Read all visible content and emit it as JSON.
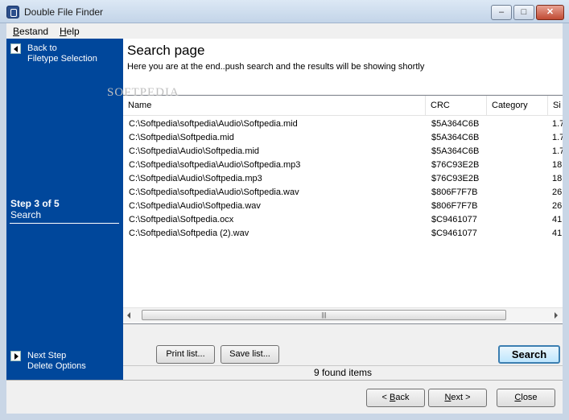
{
  "window": {
    "title": "Double File Finder",
    "minimize": "–",
    "maximize": "□",
    "close": "✕"
  },
  "menu": {
    "bestand": {
      "first": "B",
      "rest": "estand"
    },
    "help": {
      "first": "H",
      "rest": "elp"
    }
  },
  "sidebar": {
    "back_line1": "Back to",
    "back_line2": "Filetype Selection",
    "step": "Step 3 of 5",
    "step_name": "Search",
    "next_line1": "Next Step",
    "next_line2": "Delete Options"
  },
  "header": {
    "title": "Search page",
    "subtitle": "Here you are at the end..push search and the results will be showing shortly",
    "watermark": "SOFTPEDIA"
  },
  "table": {
    "columns": [
      "Name",
      "CRC",
      "Category",
      "Si"
    ],
    "rows": [
      {
        "name": "C:\\Softpedia\\softpedia\\Audio\\Softpedia.mid",
        "crc": "$5A364C6B",
        "size": "1.7"
      },
      {
        "name": "C:\\Softpedia\\Softpedia.mid",
        "crc": "$5A364C6B",
        "size": "1.7"
      },
      {
        "name": "C:\\Softpedia\\Audio\\Softpedia.mid",
        "crc": "$5A364C6B",
        "size": "1.7"
      },
      {
        "name": "C:\\Softpedia\\softpedia\\Audio\\Softpedia.mp3",
        "crc": "$76C93E2B",
        "size": "18"
      },
      {
        "name": "C:\\Softpedia\\Audio\\Softpedia.mp3",
        "crc": "$76C93E2B",
        "size": "18"
      },
      {
        "name": "C:\\Softpedia\\softpedia\\Audio\\Softpedia.wav",
        "crc": "$806F7F7B",
        "size": "26"
      },
      {
        "name": "C:\\Softpedia\\Audio\\Softpedia.wav",
        "crc": "$806F7F7B",
        "size": "26"
      },
      {
        "name": "C:\\Softpedia\\Softpedia.ocx",
        "crc": "$C9461077",
        "size": "41"
      },
      {
        "name": "C:\\Softpedia\\Softpedia (2).wav",
        "crc": "$C9461077",
        "size": "41"
      }
    ]
  },
  "scroll": {
    "grip": "|||"
  },
  "buttons": {
    "print": "Print list...",
    "save": "Save list...",
    "search": "Search",
    "back": {
      "first": "B",
      "rest": "ack",
      "arrow": "< "
    },
    "next": {
      "first": "N",
      "rest": "ext",
      "arrow": " >"
    },
    "close": {
      "first": "C",
      "rest": "lose"
    }
  },
  "status": {
    "found": "9 found items"
  }
}
